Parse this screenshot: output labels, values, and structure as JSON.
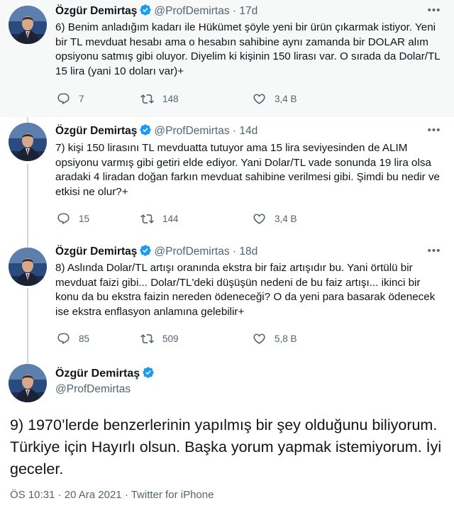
{
  "colors": {
    "verified": "#1d9bf0",
    "text": "#0f1419",
    "secondary": "#536471",
    "highlight_bg": "#f7f9f9"
  },
  "icons": {
    "reply": "reply-icon",
    "retweet": "retweet-icon",
    "like": "heart-icon",
    "more": "more-icon",
    "verified": "verified-badge-icon"
  },
  "tweets": [
    {
      "name": "Özgür Demirtaş",
      "handle": "@ProfDemirtas",
      "separator": "·",
      "time": "17d",
      "more": "•••",
      "text": "6) Benim anladığım kadarı ile Hükümet şöyle yeni bir ürün çıkarmak istiyor. Yeni bir TL mevduat hesabı ama o hesabın sahibine aynı zamanda bir DOLAR alım opsiyonu satmış gibi oluyor. Diyelim ki kişinin 150 lirası var. O sırada da Dolar/TL 15 lira (yani 10 doları var)+",
      "replies": "7",
      "retweets": "148",
      "likes": "3,4 B"
    },
    {
      "name": "Özgür Demirtaş",
      "handle": "@ProfDemirtas",
      "separator": "·",
      "time": "14d",
      "more": "•••",
      "text": "7) kişi 150 lirasını TL mevduatta tutuyor ama 15 lira seviyesinden de ALIM opsiyonu varmış gibi getiri elde ediyor. Yani Dolar/TL vade sonunda 19 lira olsa aradaki 4 liradan doğan farkın mevduat sahibine verilmesi gibi. Şimdi bu nedir ve etkisi ne olur?+",
      "replies": "15",
      "retweets": "144",
      "likes": "3,4 B"
    },
    {
      "name": "Özgür Demirtaş",
      "handle": "@ProfDemirtas",
      "separator": "·",
      "time": "18d",
      "more": "•••",
      "text": "8) Aslında Dolar/TL artışı oranında ekstra bir faiz artışıdır bu. Yani örtülü bir mevduat faizi gibi... Dolar/TL'deki düşüşün nedeni de bu faiz artışı... ikinci bir konu da bu ekstra faizin nereden ödeneceği? O da yeni para basarak ödenecek ise ekstra enflasyon anlamına gelebilir+",
      "replies": "85",
      "retweets": "509",
      "likes": "5,8 B"
    }
  ],
  "main_tweet": {
    "name": "Özgür Demirtaş",
    "handle": "@ProfDemirtas",
    "text": "9) 1970’lerde benzerlerinin yapılmış bir şey olduğunu biliyorum. Türkiye için Hayırlı olsun. Başka yorum yapmak istemiyorum. İyi geceler.",
    "time": "ÖS 10:31",
    "separator1": "·",
    "date": "20 Ara 2021",
    "separator2": "·",
    "source": "Twitter for iPhone"
  }
}
